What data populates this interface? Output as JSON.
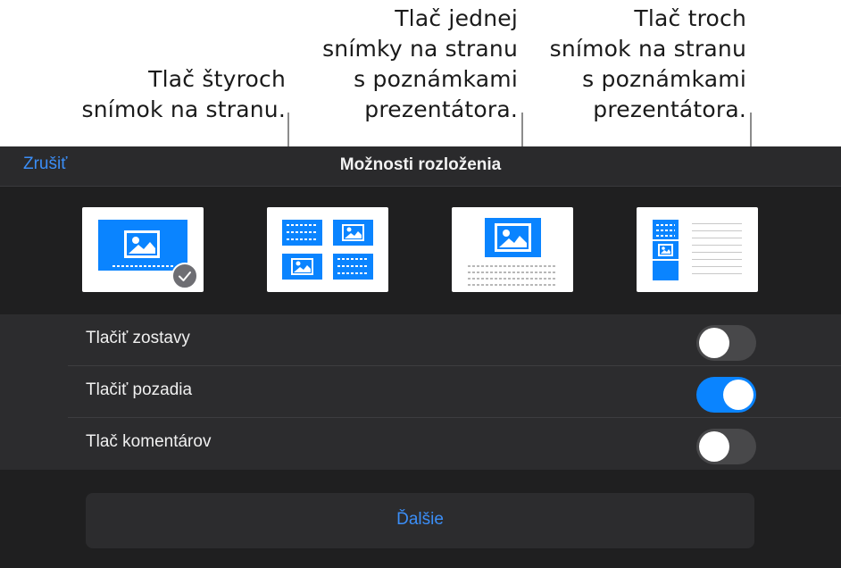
{
  "callouts": {
    "four": [
      "Tlač štyroch",
      "snímok na stranu."
    ],
    "one": [
      "Tlač jednej",
      "snímky na stranu",
      "s poznámkami",
      "prezentátora."
    ],
    "three": [
      "Tlač troch",
      "snímok na stranu",
      "s poznámkami",
      "prezentátora."
    ]
  },
  "navbar": {
    "cancel_label": "Zrušiť",
    "title": "Možnosti rozloženia"
  },
  "layouts": [
    {
      "name": "single-slide",
      "selected": true
    },
    {
      "name": "four-slides",
      "selected": false
    },
    {
      "name": "one-slide-with-notes",
      "selected": false
    },
    {
      "name": "three-slides-with-notes",
      "selected": false
    }
  ],
  "options": {
    "print_builds": {
      "label": "Tlačiť zostavy",
      "on": false
    },
    "print_backgrounds": {
      "label": "Tlačiť pozadia",
      "on": true
    },
    "print_comments": {
      "label": "Tlač komentárov",
      "on": false
    }
  },
  "more_label": "Ďalšie",
  "colors": {
    "accent": "#0a84ff",
    "link": "#3b8ef7",
    "sheet": "#1f1f20"
  }
}
